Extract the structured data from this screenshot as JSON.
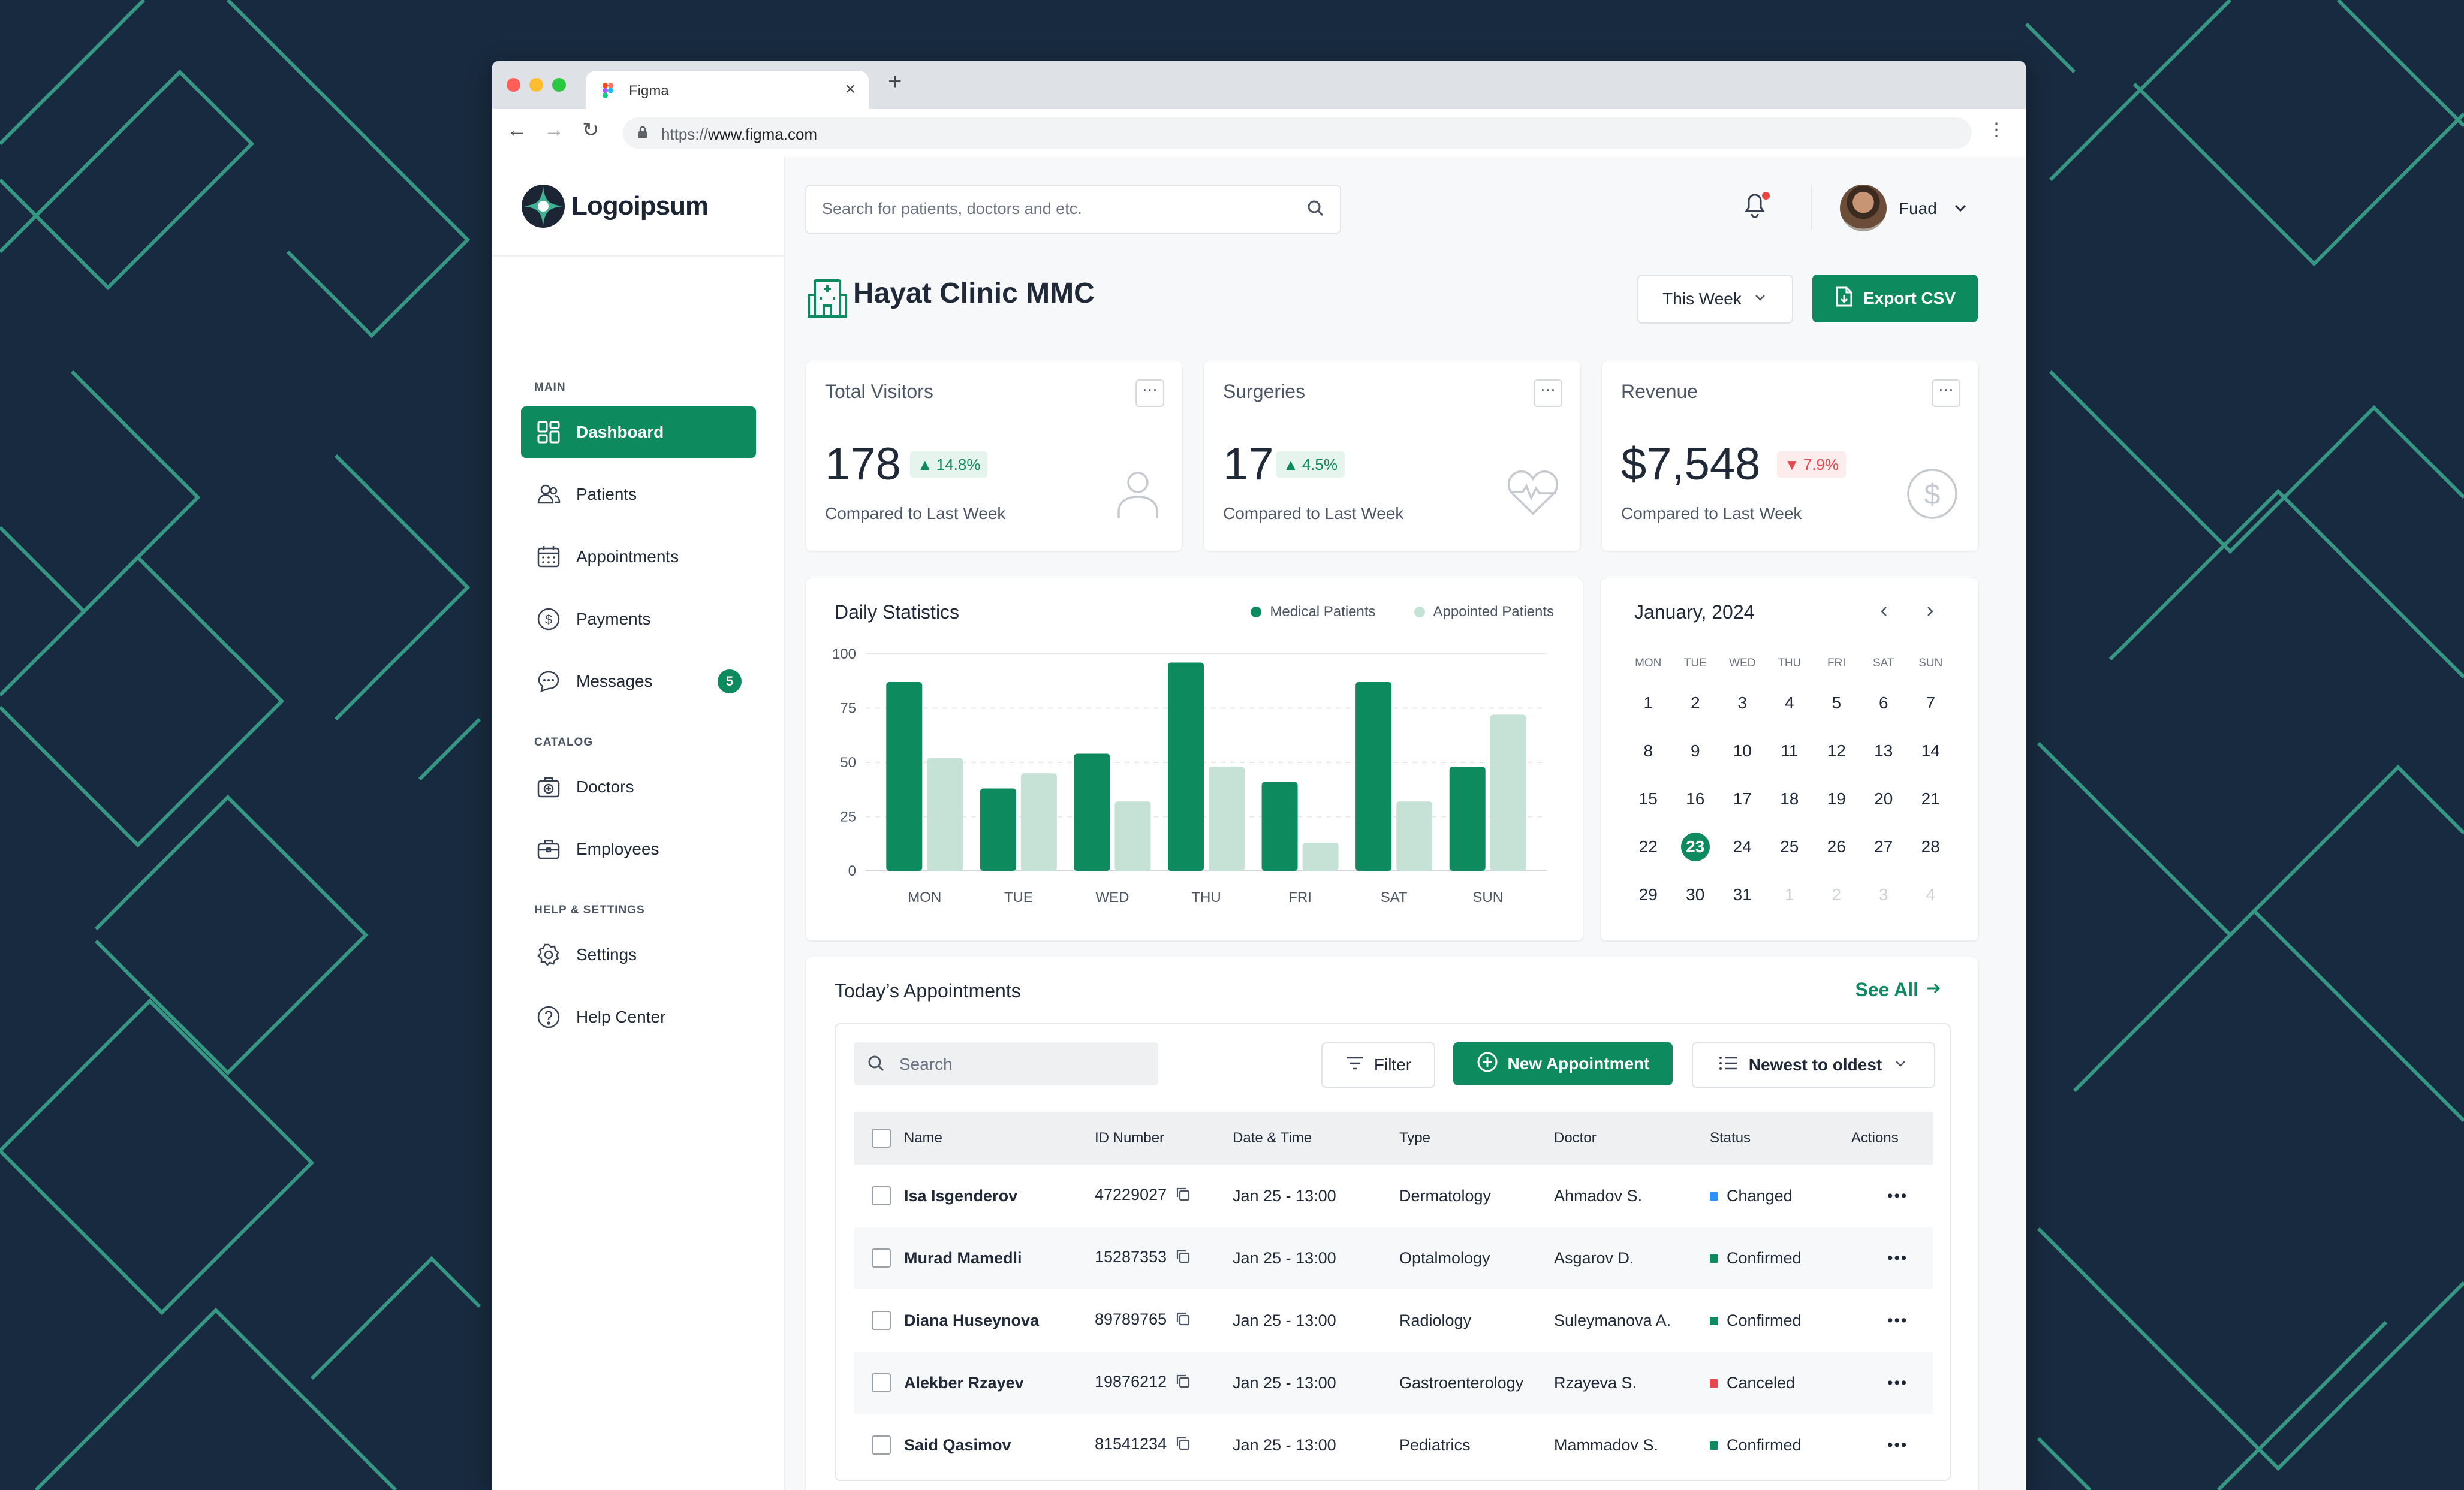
{
  "browser": {
    "tab_title": "Figma",
    "url_protocol": "https://",
    "url_host": "www.figma.com"
  },
  "brand": {
    "name": "Logoipsum"
  },
  "sidebar": {
    "sections": [
      {
        "label": "MAIN",
        "items": [
          {
            "label": "Dashboard",
            "icon": "dashboard-icon",
            "active": true
          },
          {
            "label": "Patients",
            "icon": "patients-icon"
          },
          {
            "label": "Appointments",
            "icon": "calendar-icon"
          },
          {
            "label": "Payments",
            "icon": "dollar-icon"
          },
          {
            "label": "Messages",
            "icon": "chat-icon",
            "badge": "5"
          }
        ]
      },
      {
        "label": "CATALOG",
        "items": [
          {
            "label": "Doctors",
            "icon": "medical-bag-icon"
          },
          {
            "label": "Employees",
            "icon": "briefcase-icon"
          }
        ]
      },
      {
        "label": "HELP & SETTINGS",
        "items": [
          {
            "label": "Settings",
            "icon": "gear-icon"
          },
          {
            "label": "Help Center",
            "icon": "help-icon"
          }
        ]
      }
    ]
  },
  "header": {
    "search_placeholder": "Search for patients, doctors and etc.",
    "user_name": "Fuad"
  },
  "page": {
    "title": "Hayat Clinic MMC",
    "period": "This Week",
    "export_label": "Export CSV"
  },
  "stats": [
    {
      "label": "Total Visitors",
      "value": "178",
      "change": "14.8%",
      "direction": "up",
      "compare": "Compared to Last Week",
      "icon": "user-icon"
    },
    {
      "label": "Surgeries",
      "value": "17",
      "change": "4.5%",
      "direction": "up",
      "compare": "Compared to Last Week",
      "icon": "heartbeat-icon"
    },
    {
      "label": "Revenue",
      "value": "$7,548",
      "change": "7.9%",
      "direction": "down",
      "compare": "Compared to Last Week",
      "icon": "dollar-circle-icon"
    }
  ],
  "chart_data": {
    "type": "bar",
    "title": "Daily Statistics",
    "categories": [
      "MON",
      "TUE",
      "WED",
      "THU",
      "FRI",
      "SAT",
      "SUN"
    ],
    "series": [
      {
        "name": "Medical Patients",
        "color": "#0e8a5f",
        "values": [
          87,
          38,
          54,
          96,
          41,
          87,
          48
        ]
      },
      {
        "name": "Appointed Patients",
        "color": "#c6e2d6",
        "values": [
          52,
          45,
          32,
          48,
          13,
          32,
          72
        ]
      }
    ],
    "yticks": [
      0,
      25,
      50,
      75,
      100
    ],
    "ylim": [
      0,
      100
    ],
    "grid": true,
    "legend_position": "top-right"
  },
  "calendar": {
    "month_label": "January, 2024",
    "weekdays": [
      "MON",
      "TUE",
      "WED",
      "THU",
      "FRI",
      "SAT",
      "SUN"
    ],
    "weeks": [
      [
        "1",
        "2",
        "3",
        "4",
        "5",
        "6",
        "7"
      ],
      [
        "8",
        "9",
        "10",
        "11",
        "12",
        "13",
        "14"
      ],
      [
        "15",
        "16",
        "17",
        "18",
        "19",
        "20",
        "21"
      ],
      [
        "22",
        "23",
        "24",
        "25",
        "26",
        "27",
        "28"
      ],
      [
        "29",
        "30",
        "31",
        "1",
        "2",
        "3",
        "4"
      ]
    ],
    "selected": "23"
  },
  "appointments": {
    "title": "Today’s Appointments",
    "see_all": "See All",
    "search_placeholder": "Search",
    "filter_label": "Filter",
    "new_label": "New Appointment",
    "sort_label": "Newest to oldest",
    "columns": [
      "Name",
      "ID Number",
      "Date & Time",
      "Type",
      "Doctor",
      "Status",
      "Actions"
    ],
    "rows": [
      {
        "name": "Isa Isgenderov",
        "id": "47229027",
        "datetime": "Jan 25 - 13:00",
        "type": "Dermatology",
        "doctor": "Ahmadov S.",
        "status": "Changed",
        "status_color": "#2e90fa"
      },
      {
        "name": "Murad Mamedli",
        "id": "15287353",
        "datetime": "Jan 25 - 13:00",
        "type": "Optalmology",
        "doctor": "Asgarov D.",
        "status": "Confirmed",
        "status_color": "#0e8a5f"
      },
      {
        "name": "Diana Huseynova",
        "id": "89789765",
        "datetime": "Jan 25 - 13:00",
        "type": "Radiology",
        "doctor": "Suleymanova A.",
        "status": "Confirmed",
        "status_color": "#0e8a5f"
      },
      {
        "name": "Alekber Rzayev",
        "id": "19876212",
        "datetime": "Jan 25 - 13:00",
        "type": "Gastroenterology",
        "doctor": "Rzayeva S.",
        "status": "Canceled",
        "status_color": "#e5484d"
      },
      {
        "name": "Said Qasimov",
        "id": "81541234",
        "datetime": "Jan 25 - 13:00",
        "type": "Pediatrics",
        "doctor": "Mammadov S.",
        "status": "Confirmed",
        "status_color": "#0e8a5f"
      }
    ]
  },
  "colors": {
    "accent": "#0e8a5f",
    "accent_light": "#c6e2d6",
    "background": "#182a3f",
    "pattern": "#3fb394"
  }
}
